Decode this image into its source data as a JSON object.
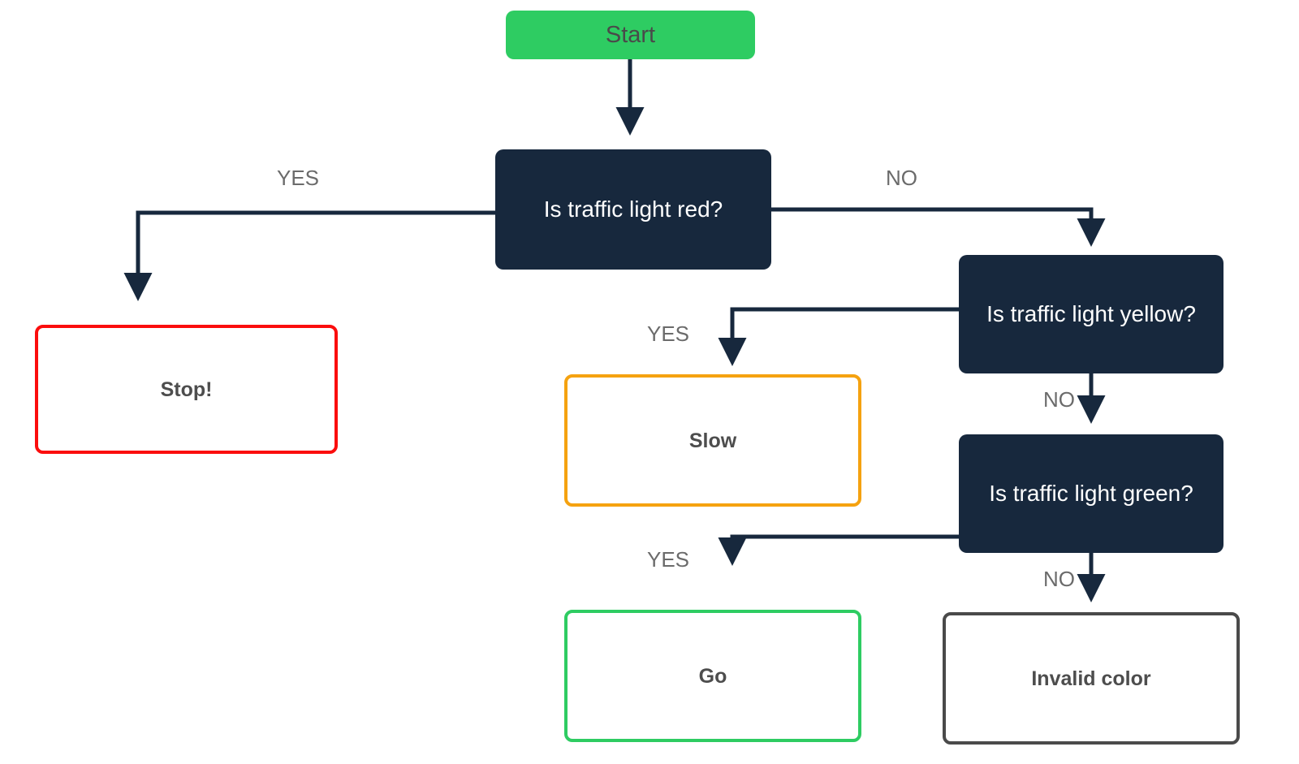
{
  "diagram": {
    "title": "Traffic light decision flowchart",
    "background": "#ffffff",
    "edge_color": "#17283d",
    "label_color": "#6b6b6b"
  },
  "nodes": {
    "start": {
      "label": "Start",
      "kind": "terminal",
      "fill": "#2ecc62",
      "text_color": "#4a4a4a"
    },
    "red_q": {
      "label": "Is traffic light red?",
      "kind": "decision",
      "fill": "#17283d",
      "text_color": "#ffffff"
    },
    "yellow_q": {
      "label": "Is traffic light yellow?",
      "kind": "decision",
      "fill": "#17283d",
      "text_color": "#ffffff"
    },
    "green_q": {
      "label": "Is traffic light green?",
      "kind": "decision",
      "fill": "#17283d",
      "text_color": "#ffffff"
    },
    "stop": {
      "label": "Stop!",
      "kind": "outcome",
      "border": "#fb0d0d",
      "fill": "#ffffff",
      "text_color": "#4d4d4d"
    },
    "slow": {
      "label": "Slow",
      "kind": "outcome",
      "border": "#f5a210",
      "fill": "#ffffff",
      "text_color": "#4d4d4d"
    },
    "go": {
      "label": "Go",
      "kind": "outcome",
      "border": "#2ecc62",
      "fill": "#ffffff",
      "text_color": "#4d4d4d"
    },
    "invalid": {
      "label": "Invalid color",
      "kind": "outcome",
      "border": "#4a4a4a",
      "fill": "#ffffff",
      "text_color": "#4d4d4d"
    }
  },
  "edge_labels": {
    "red_yes": "YES",
    "red_no": "NO",
    "yellow_yes": "YES",
    "yellow_no": "NO",
    "green_yes": "YES",
    "green_no": "NO"
  },
  "edges": [
    {
      "from": "start",
      "to": "red_q",
      "label": ""
    },
    {
      "from": "red_q",
      "to": "stop",
      "label": "YES"
    },
    {
      "from": "red_q",
      "to": "yellow_q",
      "label": "NO"
    },
    {
      "from": "yellow_q",
      "to": "slow",
      "label": "YES"
    },
    {
      "from": "yellow_q",
      "to": "green_q",
      "label": "NO"
    },
    {
      "from": "green_q",
      "to": "go",
      "label": "YES"
    },
    {
      "from": "green_q",
      "to": "invalid",
      "label": "NO"
    }
  ]
}
